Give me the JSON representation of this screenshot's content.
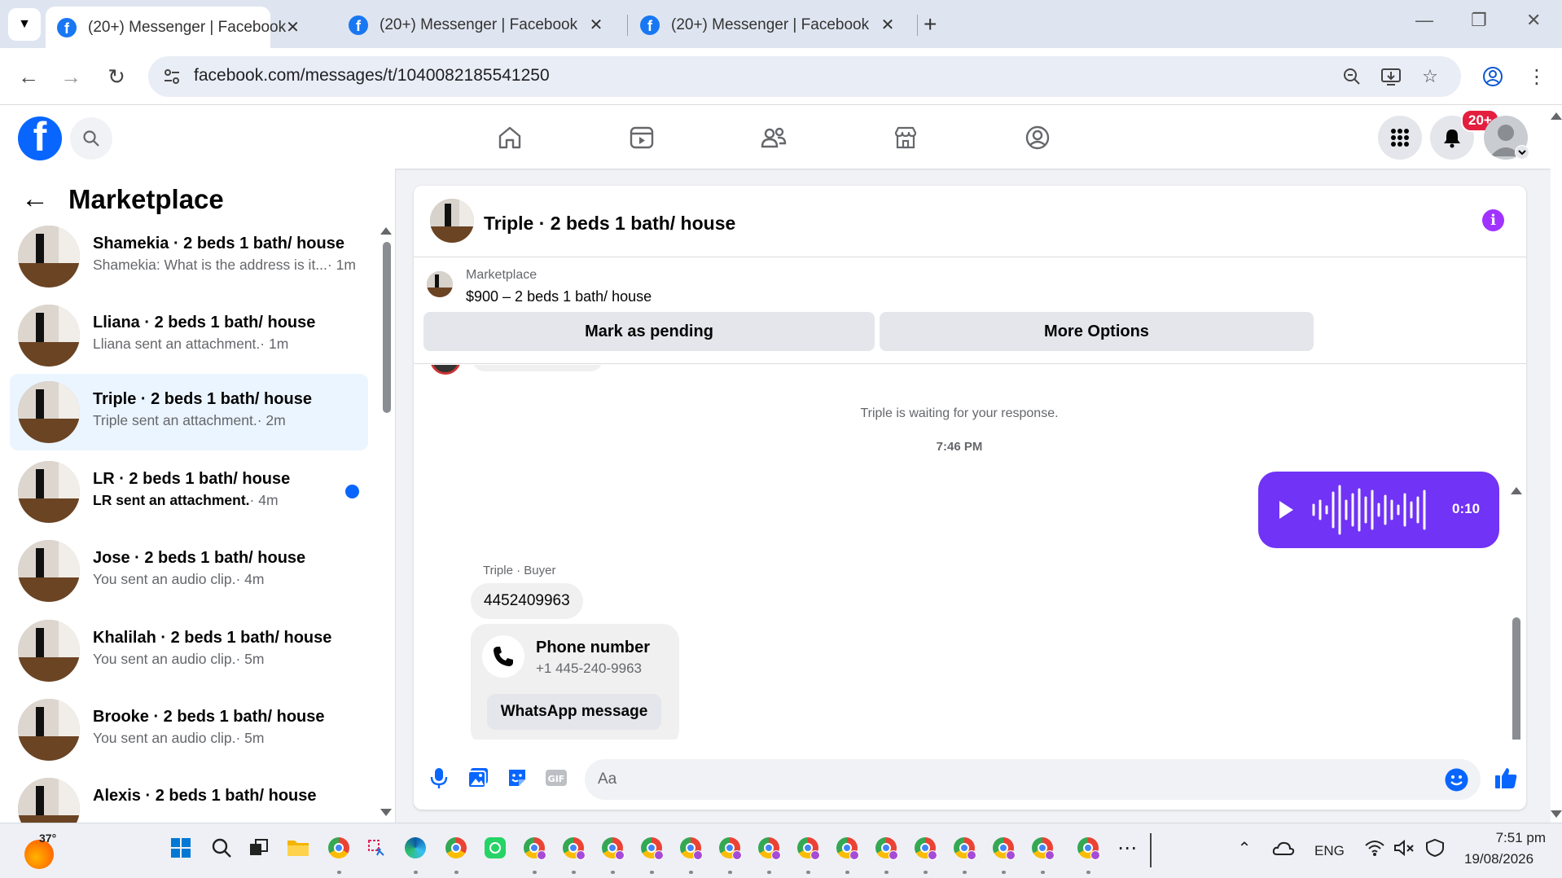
{
  "browser": {
    "tabs": [
      {
        "title": "(20+) Messenger | Facebook",
        "active": true
      },
      {
        "title": "(20+) Messenger | Facebook",
        "active": false
      },
      {
        "title": "(20+) Messenger | Facebook",
        "active": false
      }
    ],
    "url": "facebook.com/messages/t/1040082185541250"
  },
  "fb_header": {
    "notification_badge": "20+"
  },
  "sidebar": {
    "title": "Marketplace",
    "conversations": [
      {
        "name": "Shamekia · 2 beds 1 bath/ house",
        "preview": "Shamekia: What is the address is it...",
        "time": "· 1m",
        "unread": false,
        "active": false
      },
      {
        "name": "Lliana · 2 beds 1 bath/ house",
        "preview": "Lliana sent an attachment.",
        "time": "· 1m",
        "unread": false,
        "active": false
      },
      {
        "name": "Triple · 2 beds 1 bath/ house",
        "preview": "Triple sent an attachment.",
        "time": "· 2m",
        "unread": false,
        "active": true
      },
      {
        "name": "LR · 2 beds 1 bath/ house",
        "preview": "LR sent an attachment.",
        "time": "· 4m",
        "unread": true,
        "active": false
      },
      {
        "name": "Jose · 2 beds 1 bath/ house",
        "preview": "You sent an audio clip.",
        "time": "· 4m",
        "unread": false,
        "active": false
      },
      {
        "name": "Khalilah · 2 beds 1 bath/ house",
        "preview": "You sent an audio clip.",
        "time": "· 5m",
        "unread": false,
        "active": false
      },
      {
        "name": "Brooke · 2 beds 1 bath/ house",
        "preview": "You sent an audio clip.",
        "time": "· 5m",
        "unread": false,
        "active": false
      },
      {
        "name": "Alexis · 2 beds 1 bath/ house",
        "preview": "",
        "time": "",
        "unread": false,
        "active": false
      }
    ]
  },
  "chat": {
    "title": "Triple · 2 beds 1 bath/ house",
    "marketplace_label": "Marketplace",
    "listing": "$900 – 2 beds 1 bath/ house",
    "mark_pending": "Mark as pending",
    "more_options": "More Options",
    "waiting_text": "Triple is waiting for your response.",
    "timestamp": "7:46 PM",
    "audio_duration": "0:10",
    "sender_label": "Triple · Buyer",
    "number_message": "4452409963",
    "phone_card_title": "Phone number",
    "phone_card_number": "+1 445-240-9963",
    "whatsapp_button": "WhatsApp message",
    "compose_placeholder": "Aa"
  },
  "taskbar": {
    "weather_temp": "37°",
    "language": "ENG",
    "time": "7:51 pm",
    "date": "19/08/2026"
  },
  "colors": {
    "facebook_blue": "#0866ff",
    "audio_bubble": "#7133f5",
    "selected_row": "#ebf5ff",
    "badge_red": "#e41e3f"
  }
}
